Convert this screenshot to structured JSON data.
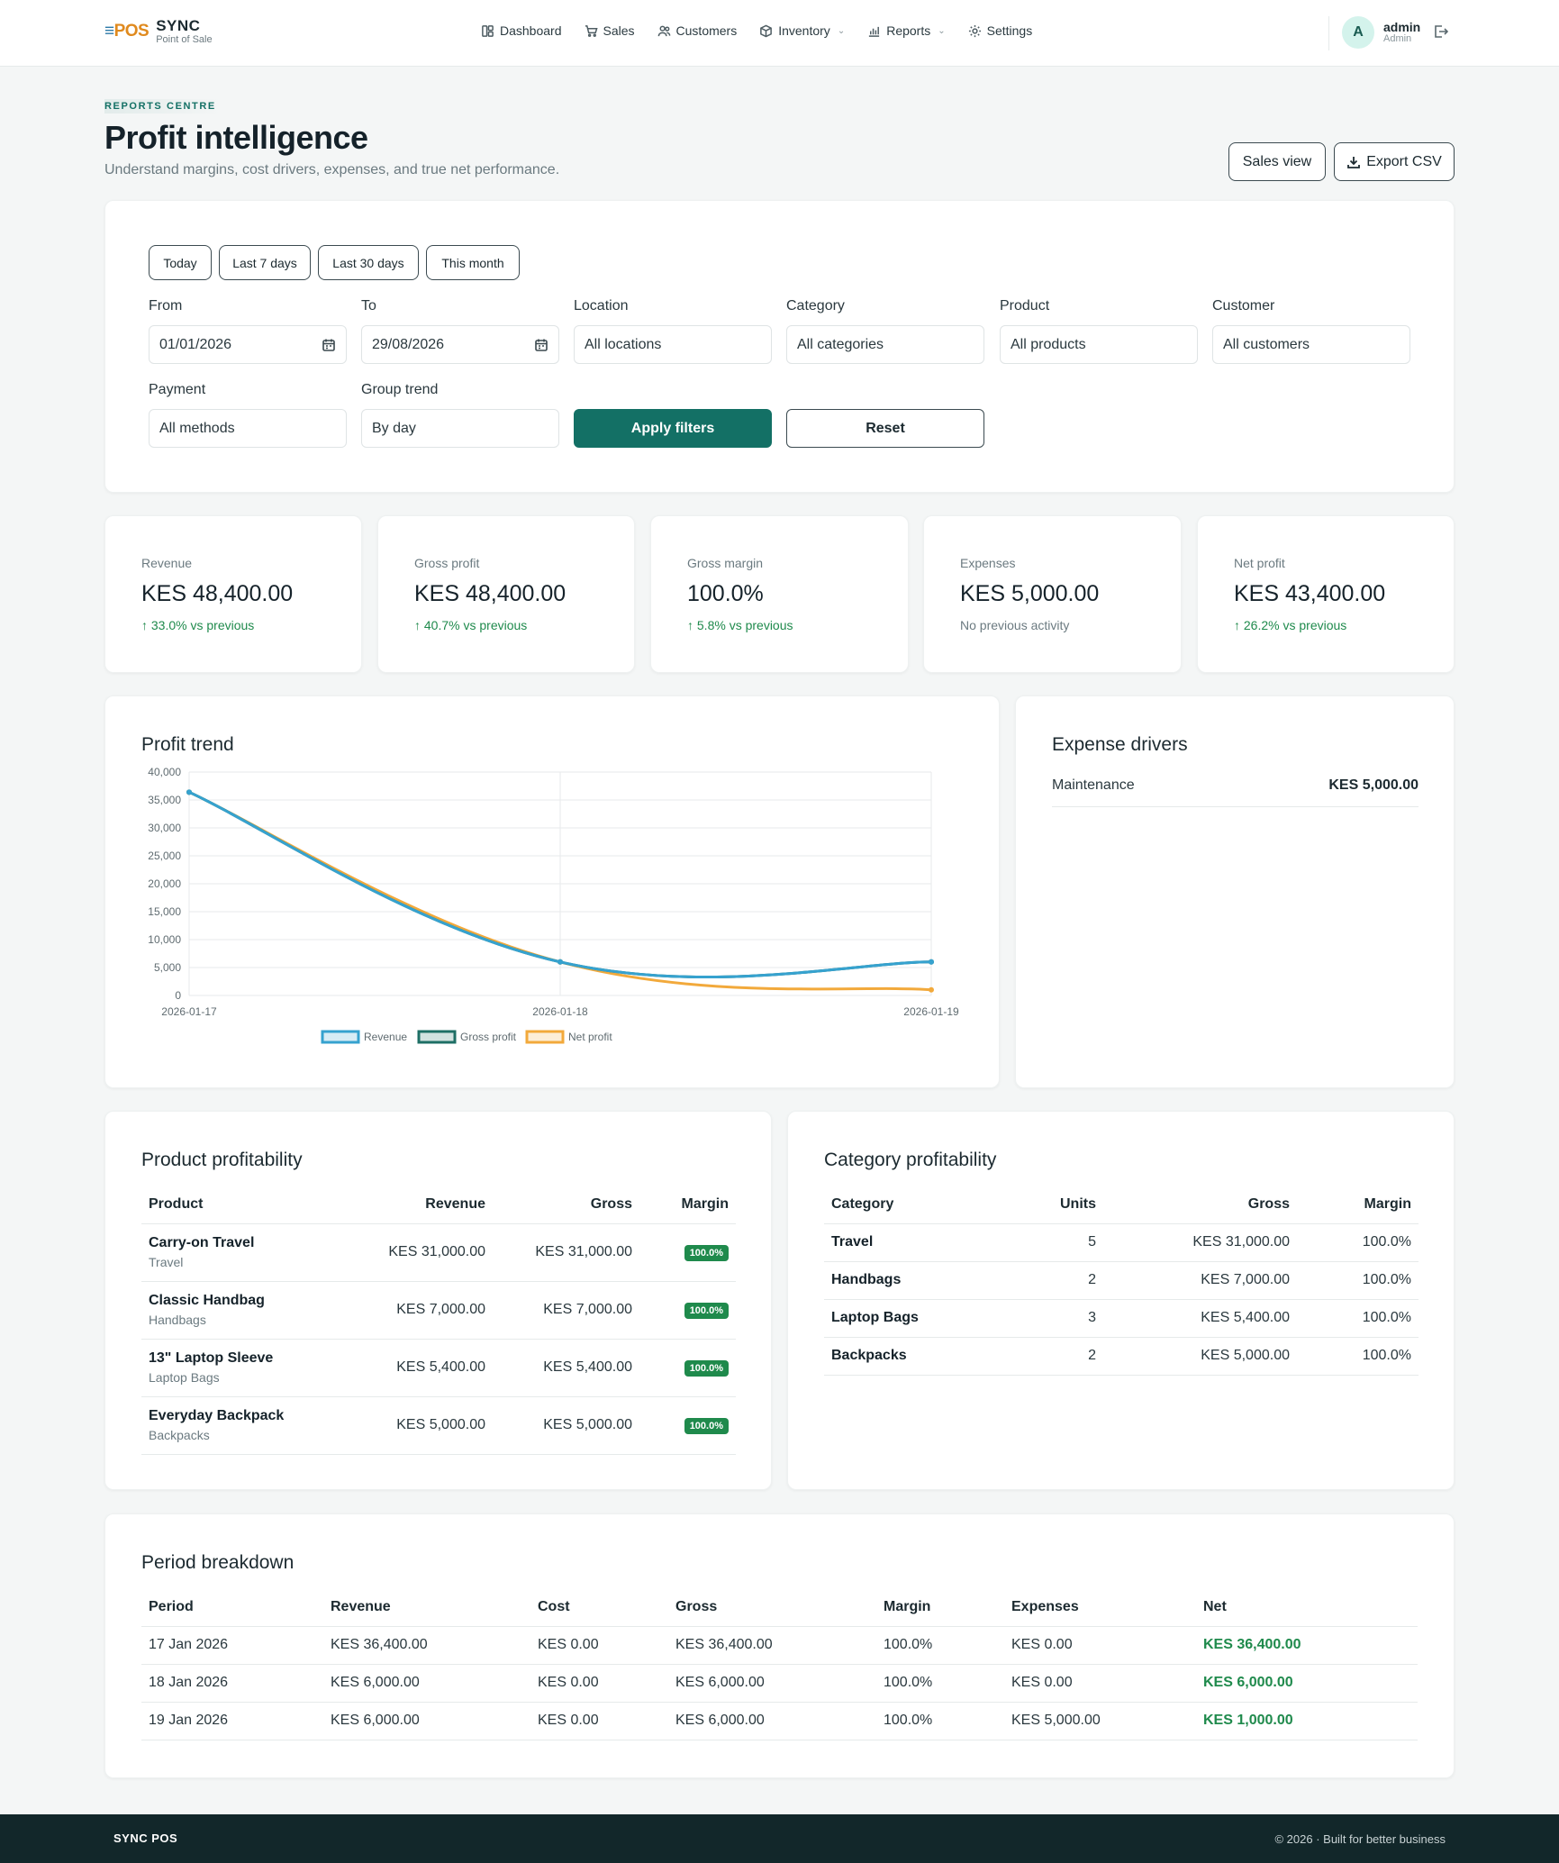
{
  "brand": {
    "logo_a": "≡",
    "logo_b": "POS",
    "name": "SYNC",
    "sub": "Point of Sale"
  },
  "nav": {
    "dashboard": "Dashboard",
    "sales": "Sales",
    "customers": "Customers",
    "inventory": "Inventory",
    "reports": "Reports",
    "settings": "Settings"
  },
  "user": {
    "initial": "A",
    "name": "admin",
    "role": "Admin"
  },
  "header": {
    "eyebrow": "REPORTS CENTRE",
    "title": "Profit intelligence",
    "subtitle": "Understand margins, cost drivers, expenses, and true net performance.",
    "sales_view": "Sales view",
    "export_csv": "Export CSV"
  },
  "filters": {
    "presets": [
      "Today",
      "Last 7 days",
      "Last 30 days",
      "This month"
    ],
    "from_label": "From",
    "from_value": "01/01/2026",
    "to_label": "To",
    "to_value": "29/08/2026",
    "location_label": "Location",
    "location_value": "All locations",
    "category_label": "Category",
    "category_value": "All categories",
    "product_label": "Product",
    "product_value": "All products",
    "customer_label": "Customer",
    "customer_value": "All customers",
    "payment_label": "Payment",
    "payment_value": "All methods",
    "group_label": "Group trend",
    "group_value": "By day",
    "apply": "Apply filters",
    "reset": "Reset"
  },
  "kpis": [
    {
      "label": "Revenue",
      "value": "KES 48,400.00",
      "trend": "↑ 33.0% vs previous"
    },
    {
      "label": "Gross profit",
      "value": "KES 48,400.00",
      "trend": "↑ 40.7% vs previous"
    },
    {
      "label": "Gross margin",
      "value": "100.0%",
      "trend": "↑ 5.8% vs previous"
    },
    {
      "label": "Expenses",
      "value": "KES 5,000.00",
      "trend": "No previous activity"
    },
    {
      "label": "Net profit",
      "value": "KES 43,400.00",
      "trend": "↑ 26.2% vs previous"
    }
  ],
  "profit_trend": {
    "title": "Profit trend"
  },
  "chart_data": {
    "type": "line",
    "title": "Profit trend",
    "categories": [
      "2026-01-17",
      "2026-01-18",
      "2026-01-19"
    ],
    "series": [
      {
        "name": "Revenue",
        "values": [
          36400,
          6000,
          6000
        ],
        "color": "#36a2cf"
      },
      {
        "name": "Gross profit",
        "values": [
          36400,
          6000,
          6000
        ],
        "color": "#1e6f65"
      },
      {
        "name": "Net profit",
        "values": [
          36400,
          6000,
          1000
        ],
        "color": "#f2a93b"
      }
    ],
    "ylim": [
      0,
      40000
    ],
    "yticks": [
      "0",
      "5,000",
      "10,000",
      "15,000",
      "20,000",
      "25,000",
      "30,000",
      "35,000",
      "40,000"
    ],
    "grid": true,
    "legend": "bottom"
  },
  "expense_drivers": {
    "title": "Expense drivers",
    "rows": [
      {
        "name": "Maintenance",
        "amount": "KES 5,000.00"
      }
    ]
  },
  "product_table": {
    "title": "Product profitability",
    "headers": [
      "Product",
      "Revenue",
      "Gross",
      "Margin"
    ],
    "rows": [
      {
        "name": "Carry-on Travel",
        "category": "Travel",
        "revenue": "KES 31,000.00",
        "gross": "KES 31,000.00",
        "margin": "100.0%"
      },
      {
        "name": "Classic Handbag",
        "category": "Handbags",
        "revenue": "KES 7,000.00",
        "gross": "KES 7,000.00",
        "margin": "100.0%"
      },
      {
        "name": "13\" Laptop Sleeve",
        "category": "Laptop Bags",
        "revenue": "KES 5,400.00",
        "gross": "KES 5,400.00",
        "margin": "100.0%"
      },
      {
        "name": "Everyday Backpack",
        "category": "Backpacks",
        "revenue": "KES 5,000.00",
        "gross": "KES 5,000.00",
        "margin": "100.0%"
      }
    ]
  },
  "category_table": {
    "title": "Category profitability",
    "headers": [
      "Category",
      "Units",
      "Gross",
      "Margin"
    ],
    "rows": [
      {
        "category": "Travel",
        "units": "5",
        "gross": "KES 31,000.00",
        "margin": "100.0%"
      },
      {
        "category": "Handbags",
        "units": "2",
        "gross": "KES 7,000.00",
        "margin": "100.0%"
      },
      {
        "category": "Laptop Bags",
        "units": "3",
        "gross": "KES 5,400.00",
        "margin": "100.0%"
      },
      {
        "category": "Backpacks",
        "units": "2",
        "gross": "KES 5,000.00",
        "margin": "100.0%"
      }
    ]
  },
  "period_table": {
    "title": "Period breakdown",
    "headers": [
      "Period",
      "Revenue",
      "Cost",
      "Gross",
      "Margin",
      "Expenses",
      "Net"
    ],
    "rows": [
      {
        "period": "17 Jan 2026",
        "revenue": "KES 36,400.00",
        "cost": "KES 0.00",
        "gross": "KES 36,400.00",
        "margin": "100.0%",
        "expenses": "KES 0.00",
        "net": "KES 36,400.00"
      },
      {
        "period": "18 Jan 2026",
        "revenue": "KES 6,000.00",
        "cost": "KES 0.00",
        "gross": "KES 6,000.00",
        "margin": "100.0%",
        "expenses": "KES 0.00",
        "net": "KES 6,000.00"
      },
      {
        "period": "19 Jan 2026",
        "revenue": "KES 6,000.00",
        "cost": "KES 0.00",
        "gross": "KES 6,000.00",
        "margin": "100.0%",
        "expenses": "KES 5,000.00",
        "net": "KES 1,000.00"
      }
    ]
  },
  "footer": {
    "brand": "SYNC POS",
    "copy": "© 2026 · Built for better business"
  }
}
